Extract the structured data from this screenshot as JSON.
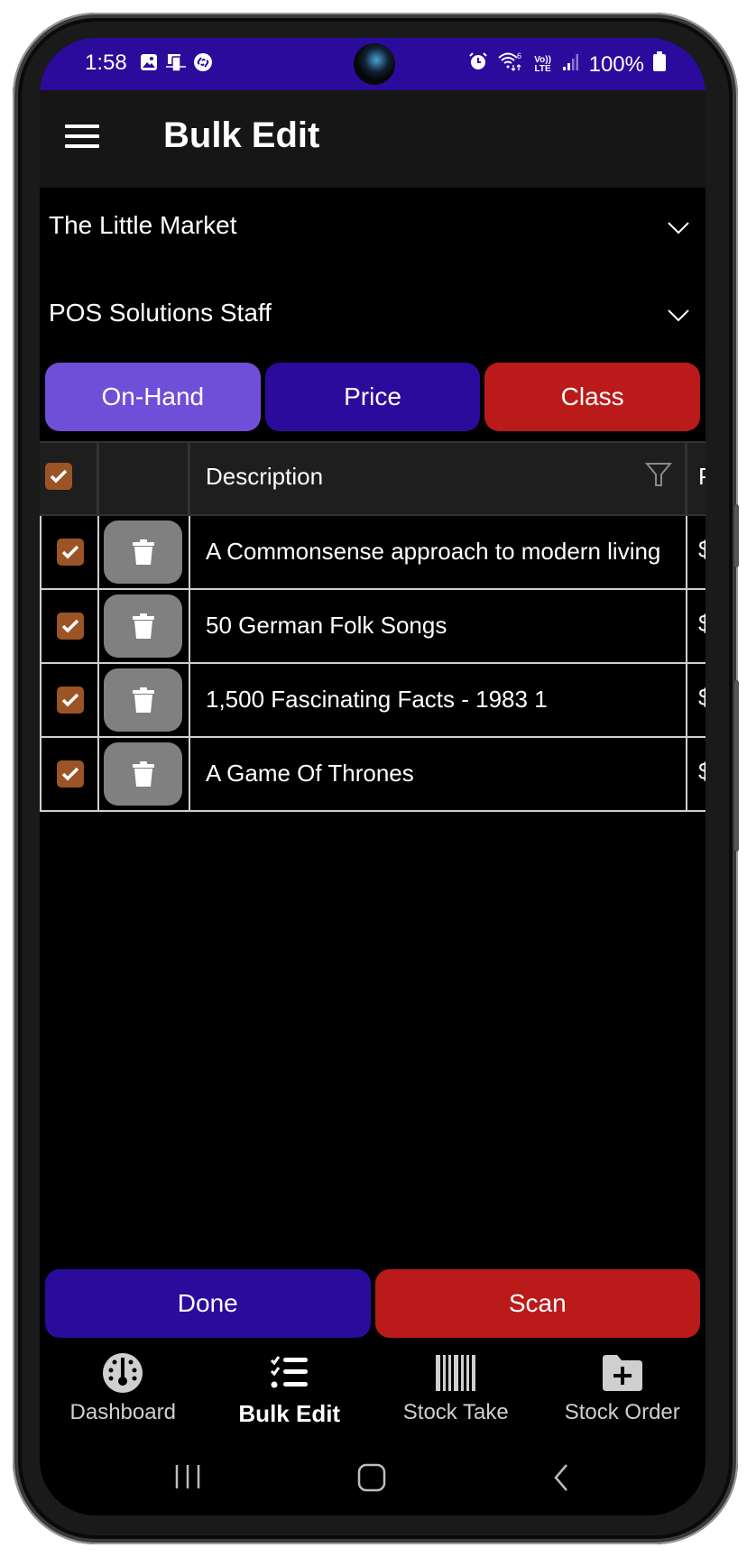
{
  "status_bar": {
    "time": "1:58",
    "left_icons": [
      "gallery-icon",
      "screen-mirror-icon",
      "shazam-icon"
    ],
    "right_icons": [
      "alarm-icon",
      "wifi-6-icon",
      "volte-icon",
      "signal-icon",
      "battery-icon"
    ],
    "wifi_label": "6",
    "volte_label": "Vo)) LTE",
    "battery": "100%"
  },
  "app_bar": {
    "menu_icon": "hamburger-menu-icon",
    "title": "Bulk Edit"
  },
  "dropdowns": [
    {
      "label": "The Little Market",
      "icon": "chevron-down-icon"
    },
    {
      "label": "POS Solutions Staff",
      "icon": "chevron-down-icon"
    }
  ],
  "tabs": [
    {
      "label": "On-Hand",
      "color": "#6f4fd8",
      "selected": true
    },
    {
      "label": "Price",
      "color": "#2b0b9b",
      "selected": false
    },
    {
      "label": "Class",
      "color": "#bb1a1a",
      "selected": false
    }
  ],
  "table": {
    "header": {
      "select_all_checked": true,
      "description_label": "Description",
      "filter_icon": "filter-icon",
      "next_column_partial": "P"
    },
    "rows": [
      {
        "checked": true,
        "description": "A Commonsense approach to modern living",
        "next_partial": "$"
      },
      {
        "checked": true,
        "description": "50 German Folk Songs",
        "next_partial": "$"
      },
      {
        "checked": true,
        "description": "1,500 Fascinating Facts - 1983 1",
        "next_partial": "$"
      },
      {
        "checked": true,
        "description": "A Game Of Thrones",
        "next_partial": "$"
      }
    ]
  },
  "actions": {
    "done_label": "Done",
    "done_color": "#2b0b9b",
    "scan_label": "Scan",
    "scan_color": "#bb1a1a"
  },
  "bottom_nav": [
    {
      "label": "Dashboard",
      "icon": "dashboard-gauge-icon",
      "active": false
    },
    {
      "label": "Bulk Edit",
      "icon": "checklist-icon",
      "active": true
    },
    {
      "label": "Stock Take",
      "icon": "barcode-icon",
      "active": false
    },
    {
      "label": "Stock Order",
      "icon": "folder-plus-icon",
      "active": false
    }
  ],
  "system_nav": [
    "recent-apps-icon",
    "home-icon",
    "back-icon"
  ],
  "colors": {
    "status_bar": "#2b0b9b",
    "checkbox": "#9a5426",
    "trash_button": "#808080"
  }
}
